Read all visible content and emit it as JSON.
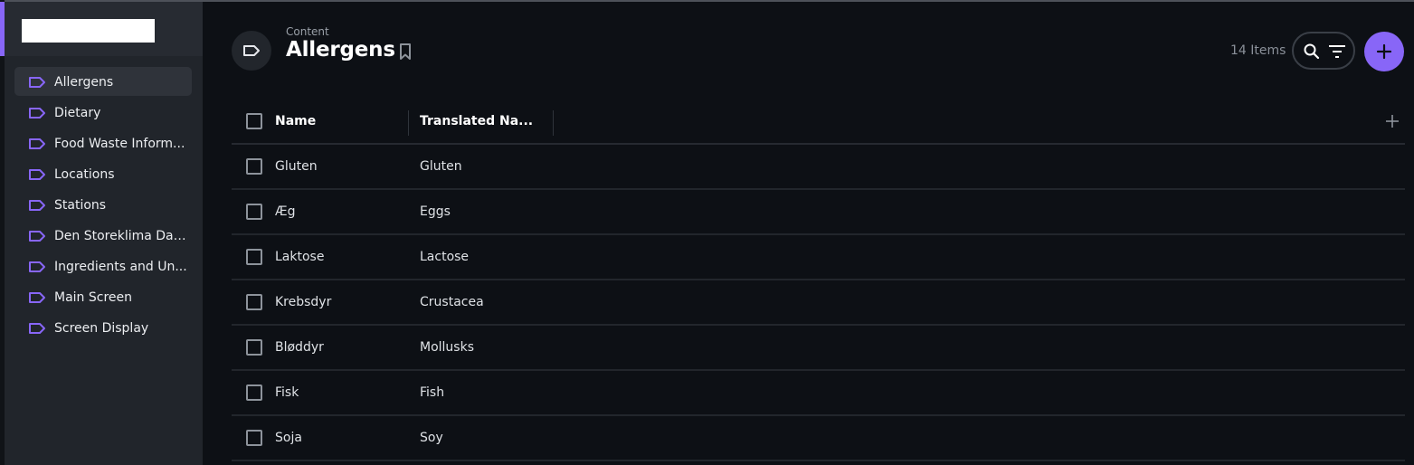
{
  "sidebar": {
    "items": [
      {
        "label": "Allergens",
        "active": true
      },
      {
        "label": "Dietary",
        "active": false
      },
      {
        "label": "Food Waste Inform...",
        "active": false
      },
      {
        "label": "Locations",
        "active": false
      },
      {
        "label": "Stations",
        "active": false
      },
      {
        "label": "Den Storeklima Dat...",
        "active": false
      },
      {
        "label": "Ingredients and Un...",
        "active": false
      },
      {
        "label": "Main Screen",
        "active": false
      },
      {
        "label": "Screen Display",
        "active": false
      }
    ],
    "item_icon": "label-tag-icon"
  },
  "header": {
    "breadcrumb": "Content",
    "title": "Allergens",
    "item_count": "14 Items"
  },
  "table": {
    "columns": [
      "Name",
      "Translated Na..."
    ],
    "rows": [
      {
        "name": "Gluten",
        "translated_name": "Gluten"
      },
      {
        "name": "Æg",
        "translated_name": "Eggs"
      },
      {
        "name": "Laktose",
        "translated_name": "Lactose"
      },
      {
        "name": "Krebsdyr",
        "translated_name": "Crustacea"
      },
      {
        "name": "Bløddyr",
        "translated_name": "Mollusks"
      },
      {
        "name": "Fisk",
        "translated_name": "Fish"
      },
      {
        "name": "Soja",
        "translated_name": "Soy"
      }
    ]
  },
  "colors": {
    "accent": "#8866f7",
    "background": "#0d1015",
    "sidebar": "#21252b"
  }
}
